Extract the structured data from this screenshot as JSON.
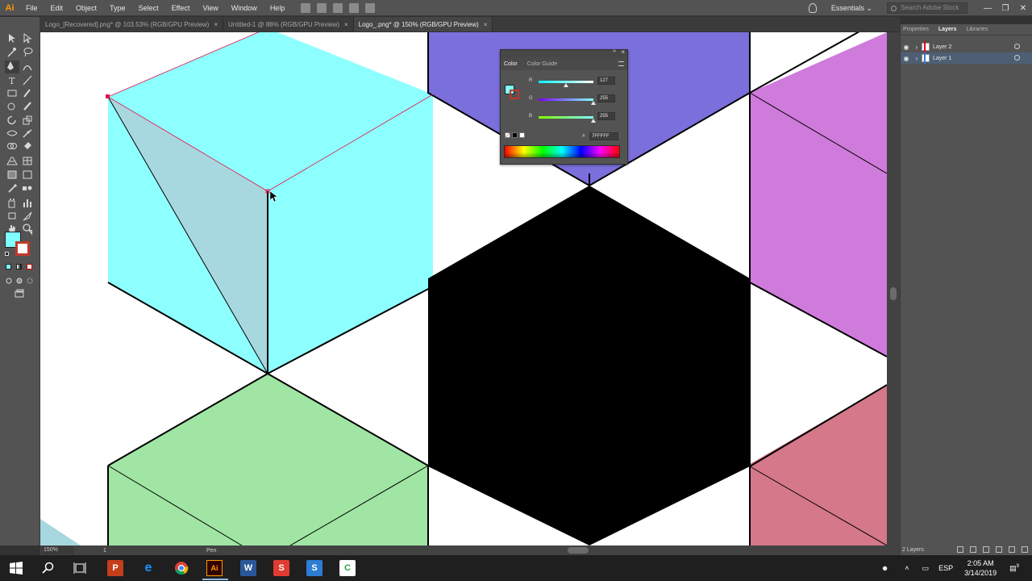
{
  "app": {
    "logo": "Ai"
  },
  "menu": [
    "File",
    "Edit",
    "Object",
    "Type",
    "Select",
    "Effect",
    "View",
    "Window",
    "Help"
  ],
  "quick_icons": [
    "bridge-icon",
    "stock-icon",
    "arrange-documents-icon",
    "gpu-performance-icon",
    "share-icon"
  ],
  "header": {
    "workspace": "Essentials",
    "search_placeholder": "Search Adobe Stock",
    "window_controls": [
      "—",
      "❐",
      "✕"
    ]
  },
  "tabs": [
    {
      "label": "Logo_[Recovered].png* @ 103.53% (RGB/GPU Preview)",
      "close": "×",
      "active": false
    },
    {
      "label": "Untitled-1 @ 88% (RGB/GPU Preview)",
      "close": "×",
      "active": false
    },
    {
      "label": "Logo_.png* @ 150% (RGB/GPU Preview)",
      "close": "×",
      "active": true
    }
  ],
  "color_panel": {
    "tabs": [
      "Color",
      "Color Guide"
    ],
    "collapse_glyph": "»",
    "close_glyph": "×",
    "channels": [
      {
        "label": "R",
        "value": "127",
        "level": 0.498,
        "gradient": [
          "#00ffff",
          "#ffffff"
        ]
      },
      {
        "label": "G",
        "value": "255",
        "level": 1.0,
        "gradient": [
          "#7f00ff",
          "#7fffff"
        ]
      },
      {
        "label": "B",
        "value": "255",
        "level": 1.0,
        "gradient": [
          "#7fff00",
          "#7fffff"
        ]
      }
    ],
    "hex_label": "#",
    "hex_value": "7FFFFF",
    "fill_color": "#7fffff",
    "stroke_color": "#c0392b"
  },
  "right_panel": {
    "tabs": [
      "Properties",
      "Layers",
      "Libraries"
    ],
    "layers": [
      {
        "name": "Layer 2",
        "color": "#e6001e",
        "selected": false
      },
      {
        "name": "Layer 1",
        "color": "#3a7bd5",
        "selected": true
      }
    ],
    "footer_text": "2 Layers"
  },
  "status": {
    "zoom": "150%",
    "artboard": "1",
    "tool": "Pen"
  },
  "taskbar": {
    "apps": [
      "start-icon",
      "search-icon",
      "task-view-icon",
      "powerpoint-icon",
      "edge-icon",
      "chrome-icon",
      "illustrator-icon",
      "word-icon",
      "app-s-red-icon",
      "app-s-blue-icon",
      "app-c-green-icon"
    ],
    "language": "ESP",
    "time": "2:05 AM",
    "date": "3/14/2019",
    "notifications": "9"
  },
  "artwork_colors": {
    "cyan": "#8effff",
    "cyan_shade": "#a8d8df",
    "purple": "#7b6fdc",
    "magenta": "#cf7bdb",
    "green": "#a0e5a3",
    "rose": "#d4788a",
    "black": "#000000"
  }
}
